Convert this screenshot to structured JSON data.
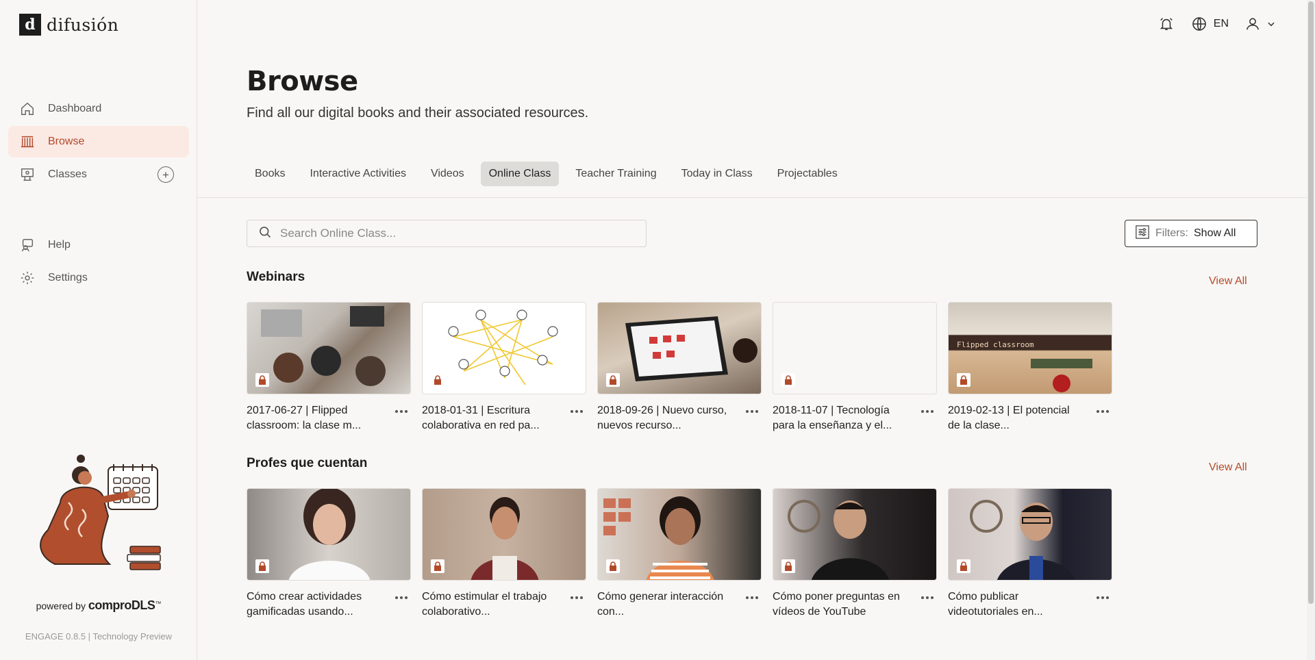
{
  "brand": {
    "mark": "d",
    "name": "difusión"
  },
  "sidebar": {
    "items": [
      {
        "label": "Dashboard",
        "icon": "home-icon"
      },
      {
        "label": "Browse",
        "icon": "library-icon",
        "active": true
      },
      {
        "label": "Classes",
        "icon": "classroom-icon"
      }
    ],
    "secondary": [
      {
        "label": "Help",
        "icon": "help-icon"
      },
      {
        "label": "Settings",
        "icon": "gear-icon"
      }
    ],
    "powered_by": "powered by",
    "powered_brand": "comproDLS",
    "powered_tm": "™",
    "version": "ENGAGE 0.8.5 | Technology Preview"
  },
  "topbar": {
    "language": "EN"
  },
  "header": {
    "title": "Browse",
    "subtitle": "Find all our digital books and their associated resources."
  },
  "tabs": [
    {
      "label": "Books"
    },
    {
      "label": "Interactive Activities"
    },
    {
      "label": "Videos"
    },
    {
      "label": "Online Class",
      "active": true
    },
    {
      "label": "Teacher Training"
    },
    {
      "label": "Today in Class"
    },
    {
      "label": "Projectables"
    }
  ],
  "search": {
    "placeholder": "Search Online Class...",
    "value": ""
  },
  "filters": {
    "label": "Filters:",
    "value": "Show All"
  },
  "sections": [
    {
      "title": "Webinars",
      "view_all": "View All",
      "cards": [
        {
          "title": "2017-06-27 | Flipped classroom: la clase m..."
        },
        {
          "title": "2018-01-31 | Escritura colaborativa en red pa..."
        },
        {
          "title": "2018-09-26 | Nuevo curso, nuevos recurso..."
        },
        {
          "title": "2018-11-07 | Tecnología para la enseñanza y el..."
        },
        {
          "title": "2019-02-13 | El potencial de la clase...",
          "thumb_text": "Flipped classroom"
        }
      ]
    },
    {
      "title": "Profes que cuentan",
      "view_all": "View All",
      "cards": [
        {
          "title": "Cómo crear actividades gamificadas usando..."
        },
        {
          "title": "Cómo estimular el trabajo colaborativo..."
        },
        {
          "title": "Cómo generar interacción con..."
        },
        {
          "title": "Cómo poner preguntas en vídeos de YouTube"
        },
        {
          "title": "Cómo publicar videotutoriales en..."
        }
      ]
    }
  ],
  "colors": {
    "accent": "#b24a2a",
    "active_bg": "#fbe9e4",
    "background": "#f9f7f5"
  }
}
